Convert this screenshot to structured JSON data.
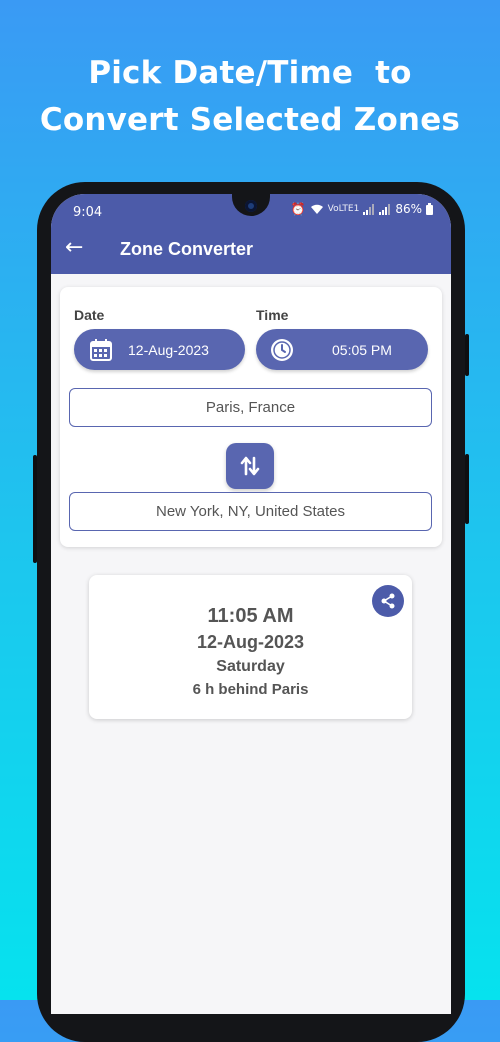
{
  "headline": {
    "line1": "Pick Date/Time  to",
    "line2": "Convert Selected Zones"
  },
  "status_bar": {
    "time": "9:04",
    "network_label": "VoLTE1",
    "battery": "86%"
  },
  "app_bar": {
    "title": "Zone Converter"
  },
  "picker": {
    "date_label": "Date",
    "time_label": "Time",
    "date_value": "12-Aug-2023",
    "time_value": "05:05 PM"
  },
  "zones": {
    "from": "Paris, France",
    "to": "New York, NY, United States"
  },
  "result": {
    "time": "11:05 AM",
    "date": "12-Aug-2023",
    "weekday": "Saturday",
    "difference": "6 h behind Paris"
  },
  "colors": {
    "primary": "#4c5ba9",
    "accent": "#5966b0",
    "bg_top": "#3a9af4",
    "bg_bottom": "#06e2ee"
  }
}
